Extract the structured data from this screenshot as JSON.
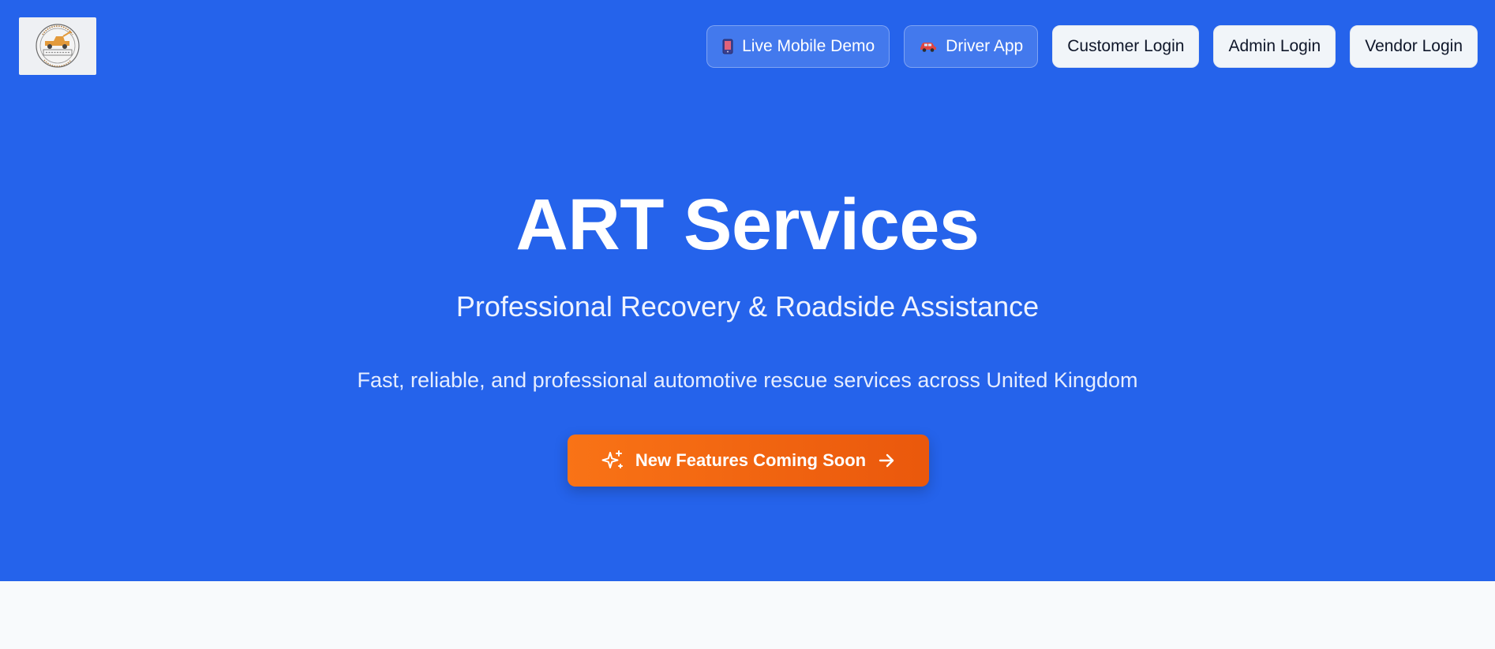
{
  "colors": {
    "hero_background": "#2563eb",
    "page_background": "#f8fafc",
    "cta_start": "#f97316",
    "cta_end": "#ea580c"
  },
  "header": {
    "logo_icon": "tow-truck-badge-logo",
    "nav": {
      "live_demo": {
        "icon": "mobile-phone-icon",
        "label": "Live Mobile Demo"
      },
      "driver_app": {
        "icon": "car-icon",
        "label": "Driver App"
      },
      "customer_login": {
        "label": "Customer Login"
      },
      "admin_login": {
        "label": "Admin Login"
      },
      "vendor_login": {
        "label": "Vendor Login"
      }
    }
  },
  "hero": {
    "title": "ART Services",
    "subtitle": "Professional Recovery & Roadside Assistance",
    "description": "Fast, reliable, and professional automotive rescue services across United Kingdom",
    "cta": {
      "label": "New Features Coming Soon",
      "leading_icon": "sparkles-icon",
      "trailing_icon": "arrow-right-icon"
    }
  }
}
